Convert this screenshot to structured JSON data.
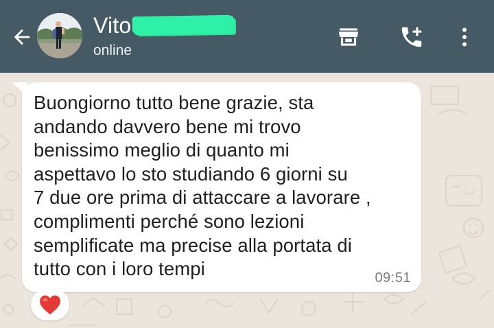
{
  "header": {
    "contact_name": "Vito",
    "status": "online",
    "background_color": "#455a64",
    "icons": {
      "back": "arrow-left-icon",
      "shop": "storefront-icon",
      "call": "add-call-icon",
      "menu": "more-vertical-icon"
    }
  },
  "chat": {
    "wallpaper_color": "#ece5dd",
    "message": {
      "lines": [
        "Buongiorno tutto bene grazie, sta",
        "andando davvero bene mi trovo",
        "benissimo meglio di quanto mi",
        "aspettavo lo sto studiando 6 giorni su",
        "7 due ore prima di attaccare a lavorare ,",
        "complimenti perché sono lezioni",
        "semplificate ma precise alla portata di",
        "tutto con i loro tempi"
      ],
      "time": "09:51",
      "reaction": "heart-emoji"
    }
  }
}
